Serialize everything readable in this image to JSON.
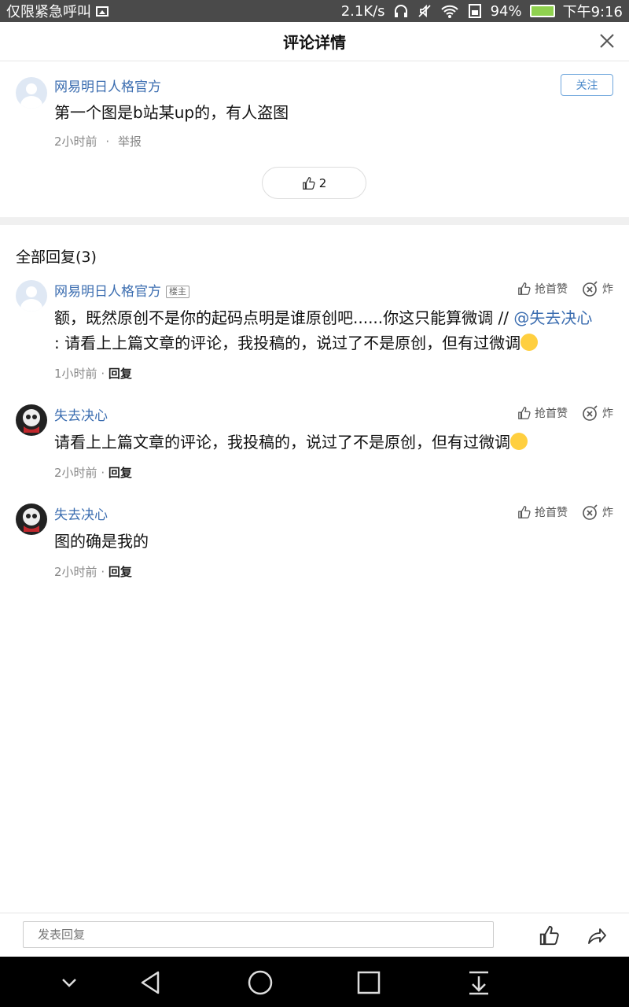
{
  "status": {
    "carrier": "仅限紧急呼叫",
    "speed": "2.1K/s",
    "battery": "94%",
    "time": "下午9:16"
  },
  "header": {
    "title": "评论详情"
  },
  "main_comment": {
    "username": "网易明日人格官方",
    "text": "第一个图是b站某up的，有人盗图",
    "time": "2小时前",
    "separator": "·",
    "report": "举报",
    "follow": "关注",
    "likes": "2"
  },
  "replies_section": {
    "title": "全部回复(3)"
  },
  "replies": [
    {
      "username": "网易明日人格官方",
      "badge": "楼主",
      "text_line1": "额，既然原创不是你的起码点明是谁原创吧......你这只能算微调 // ",
      "mention": "@失去决心",
      "text_line2": ": 请看上上篇文章的评论，我投稿的，说过了不是原创，但有过微调",
      "time": "1小时前",
      "dot": "·",
      "reply": "回复",
      "like_label": "抢首赞",
      "bomb_label": "炸"
    },
    {
      "username": "失去决心",
      "text": "请看上上篇文章的评论，我投稿的，说过了不是原创，但有过微调",
      "time": "2小时前",
      "dot": "·",
      "reply": "回复",
      "like_label": "抢首赞",
      "bomb_label": "炸"
    },
    {
      "username": "失去决心",
      "text": "图的确是我的",
      "time": "2小时前",
      "dot": "·",
      "reply": "回复",
      "like_label": "抢首赞",
      "bomb_label": "炸"
    }
  ],
  "bottom_bar": {
    "placeholder": "发表回复"
  },
  "colors": {
    "link": "#3b6db0",
    "status_bar": "#4a4a4a",
    "nav_bar": "#000000"
  }
}
